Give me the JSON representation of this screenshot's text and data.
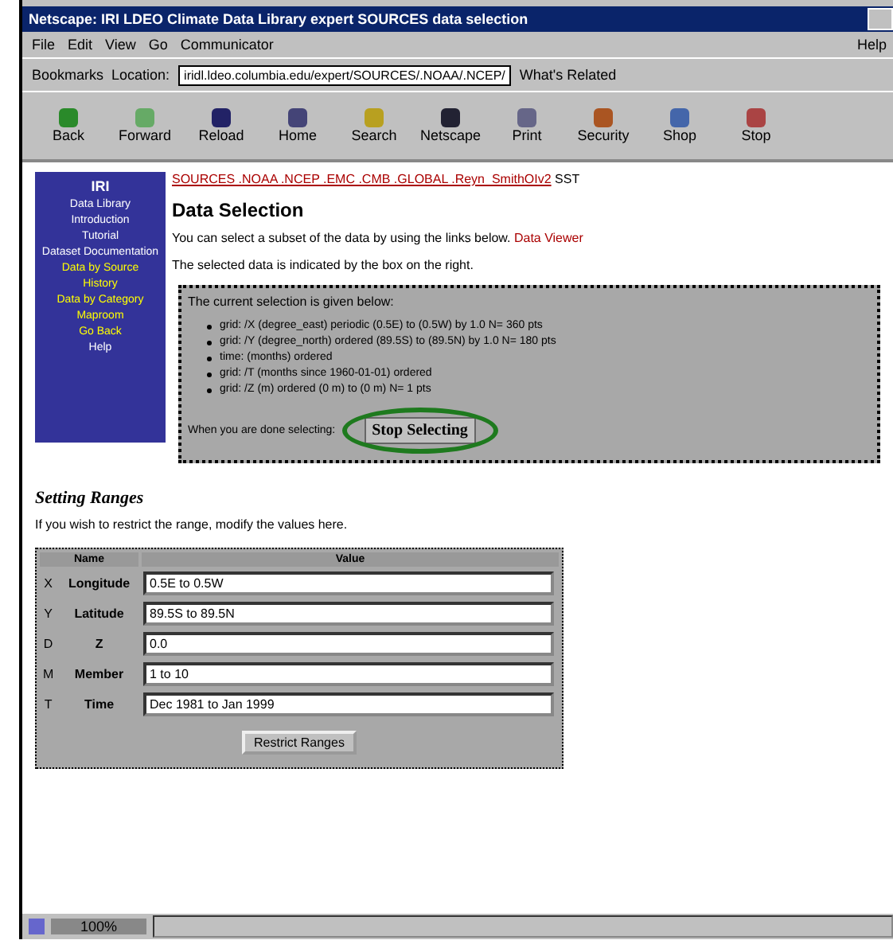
{
  "window": {
    "title": "Netscape: IRI LDEO Climate Data Library expert SOURCES data selection"
  },
  "menu": {
    "items": [
      "File",
      "Edit",
      "View",
      "Go",
      "Communicator"
    ],
    "help": "Help"
  },
  "location_bar": {
    "bookmarks_label": "Bookmarks",
    "location_label": "Location:",
    "url": "iridl.ldeo.columbia.edu/expert/SOURCES/.NOAA/.NCEP/",
    "related_label": "What's Related"
  },
  "toolbar": {
    "buttons": [
      "Back",
      "Forward",
      "Reload",
      "Home",
      "Search",
      "Netscape",
      "Print",
      "Security",
      "Shop",
      "Stop"
    ]
  },
  "page": {
    "sidebar": {
      "title": "IRI",
      "items": [
        "Data Library",
        "Introduction",
        "Tutorial",
        "Dataset Documentation",
        "Data by Source",
        "History",
        "Data by Category",
        "Maproom",
        "Go Back",
        "Help"
      ]
    },
    "header_link": "SOURCES .NOAA .NCEP .EMC .CMB .GLOBAL .Reyn_SmithOIv2",
    "header_suffix": "SST",
    "heading": "Data Selection",
    "intro": "You can select a subset of the data by using the links below.",
    "intro_link": "Data Viewer",
    "note": "The selected data is indicated by the box on the right.",
    "selection_box": {
      "title": "The current selection is given below:",
      "bullets": [
        "grid: /X (degree_east) periodic (0.5E) to (0.5W) by 1.0 N= 360 pts",
        "grid: /Y (degree_north) ordered (89.5S) to (89.5N) by 1.0 N= 180 pts",
        "time: (months) ordered",
        "grid: /T (months since 1960-01-01) ordered",
        "grid: /Z (m) ordered (0 m) to (0 m) N= 1 pts"
      ],
      "prompt": "When you are done selecting:",
      "button": "Stop Selecting"
    },
    "ranges": {
      "heading": "Setting Ranges",
      "description": "If you wish to restrict the range, modify the values here.",
      "columns": [
        "Name",
        "Value"
      ],
      "rows": [
        {
          "axis": "X",
          "name": "Longitude",
          "value": "0.5E to 0.5W"
        },
        {
          "axis": "Y",
          "name": "Latitude",
          "value": "89.5S to 89.5N"
        },
        {
          "axis": "D",
          "name": "Z",
          "value": "0.0"
        },
        {
          "axis": "M",
          "name": "Member",
          "value": "1 to 10"
        },
        {
          "axis": "T",
          "name": "Time",
          "value": "Dec 1981 to Jan 1999"
        }
      ],
      "button": "Restrict Ranges"
    }
  },
  "status_bar": {
    "text": "100%"
  }
}
